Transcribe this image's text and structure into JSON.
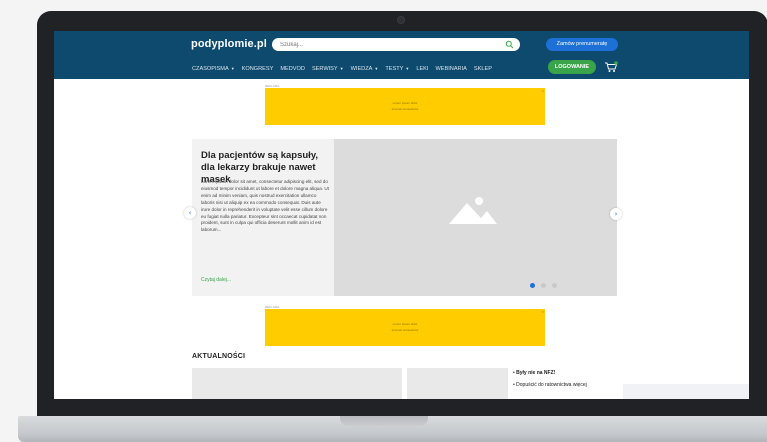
{
  "header": {
    "logo": "podyplomie.pl",
    "search_placeholder": "Szukaj...",
    "subscribe_label": "Zamów prenumeratę",
    "login_label": "LOGOWANIE",
    "nav": [
      {
        "label": "CZASOPISMA",
        "dropdown": true
      },
      {
        "label": "KONGRESY",
        "dropdown": false
      },
      {
        "label": "MEDVOD",
        "dropdown": false
      },
      {
        "label": "SERWISY",
        "dropdown": true
      },
      {
        "label": "WIEDZA",
        "dropdown": true
      },
      {
        "label": "TESTY",
        "dropdown": true
      },
      {
        "label": "LEKI",
        "dropdown": false
      },
      {
        "label": "WEBINARIA",
        "dropdown": false
      },
      {
        "label": "SKLEP",
        "dropdown": false
      }
    ]
  },
  "ads": {
    "label": "REKLAMA",
    "close": "×",
    "line1": "Lorem ipsum dolor",
    "line2": "sit amet consectetur"
  },
  "slider": {
    "title": "Dla pacjentów są kapsuły, dla lekarzy brakuje nawet masek",
    "body": "Lorem ipsum dolor sit amet, consectetur adipiscing elit, sed do eiusmod tempor incididunt ut labore et dolore magna aliqua. Ut enim ad minim veniam, quis nostrud exercitation ullamco laboris nisi ut aliquip ex ea commodo consequat. Duis aute irure dolor in reprehenderit in voluptate velit esse cillum dolore eu fugiat nulla pariatur. Excepteur sint occaecat cupidatat non proident, sunt in culpa qui officia deserunt mollit anim id est laborum...",
    "more_label": "Czytaj dalej...",
    "prev_glyph": "‹",
    "next_glyph": "›",
    "slide_count": 3,
    "active_slide": 1
  },
  "news": {
    "heading": "AKTUALNOŚCI",
    "links": [
      {
        "text": "Były nie na NFZ!",
        "bold": true
      },
      {
        "text": "Dopuścić do ratownictwa więcej",
        "bold": false
      }
    ]
  },
  "colors": {
    "header_bg": "#0e4a6e",
    "accent_blue": "#1d71d6",
    "accent_green": "#3aa44a",
    "ad_yellow": "#ffcc00"
  }
}
